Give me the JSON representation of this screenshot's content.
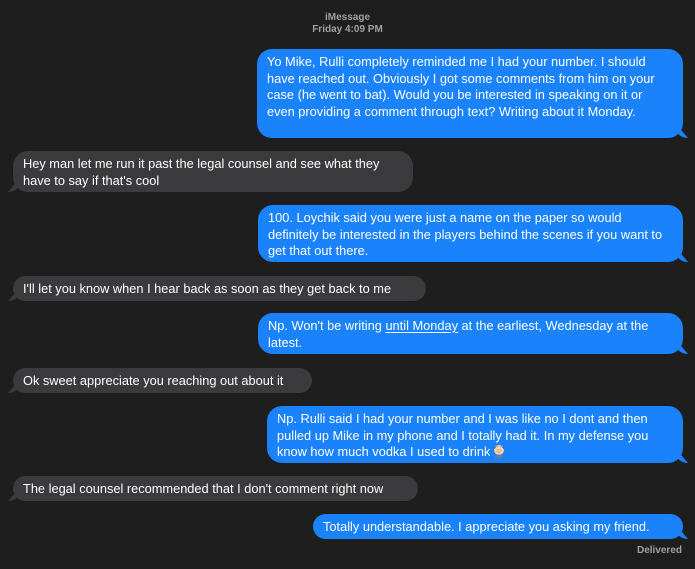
{
  "header": {
    "service": "iMessage",
    "timestamp": "Friday 4:09 PM"
  },
  "messages": [
    {
      "direction": "sent",
      "text": "Yo Mike, Rulli completely reminded me I had your number. I should have reached out. Obviously I got some comments from him on your case (he went to bat). Would you be interested in speaking on it or even providing a comment through text? Writing about it Monday."
    },
    {
      "direction": "received",
      "text": "Hey man let me run it past the legal counsel and see what they have to say if that's cool"
    },
    {
      "direction": "sent",
      "text": "100. Loychik said you were just a name on the paper so would definitely be interested in the players behind the scenes if you want to get that out there."
    },
    {
      "direction": "received",
      "text": "I'll let you know when I hear back as soon as they get back to me"
    },
    {
      "direction": "sent",
      "text_before": "Np. Won't be writing ",
      "text_link": "until Monday",
      "text_after": " at the earliest, Wednesday at the latest."
    },
    {
      "direction": "received",
      "text": "Ok sweet appreciate you reaching out about it"
    },
    {
      "direction": "sent",
      "text": "Np. Rulli said I had your number and I was like no I dont and then pulled up Mike in my phone and I totally had it. In my defense you know how much vodka I used to drink",
      "emoji": "man-facepalming-emoji"
    },
    {
      "direction": "received",
      "text": "The legal counsel recommended that I don't comment right now"
    },
    {
      "direction": "sent",
      "text": "Totally understandable. I appreciate you asking my friend."
    }
  ],
  "status": {
    "delivered": "Delivered"
  },
  "colors": {
    "background": "#1e1e1e",
    "sent_bubble": "#1a82fb",
    "received_bubble": "#3b3b3d",
    "meta_text": "#a1a1a1"
  }
}
